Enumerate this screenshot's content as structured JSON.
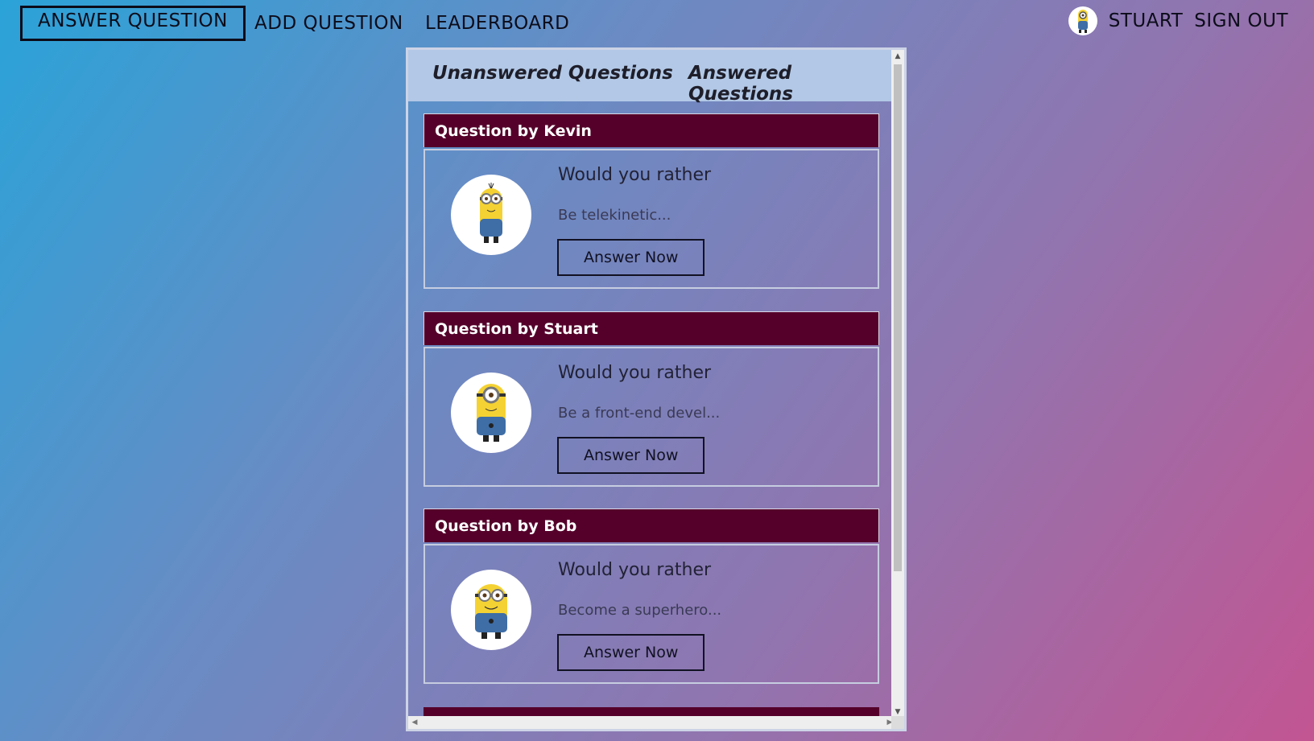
{
  "nav": {
    "answer_question": "ANSWER QUESTION",
    "add_question": "ADD QUESTION",
    "leaderboard": "LEADERBOARD"
  },
  "user": {
    "name": "STUART",
    "sign_out": "SIGN OUT",
    "avatar_icon": "minion-avatar-icon"
  },
  "tabs": {
    "unanswered": "Unanswered Questions",
    "answered": "Answered Questions"
  },
  "questions": [
    {
      "header": "Question by Kevin",
      "title": "Would you rather",
      "preview": "Be telekinetic...",
      "button": "Answer Now",
      "avatar_icon": "kevin-avatar-icon"
    },
    {
      "header": "Question by Stuart",
      "title": "Would you rather",
      "preview": "Be a front-end devel...",
      "button": "Answer Now",
      "avatar_icon": "stuart-avatar-icon"
    },
    {
      "header": "Question by Bob",
      "title": "Would you rather",
      "preview": "Become a superhero...",
      "button": "Answer Now",
      "avatar_icon": "bob-avatar-icon"
    }
  ],
  "colors": {
    "header_bg": "#55002a",
    "tabbar_bg": "#b2c8e6",
    "minion_yellow": "#f5d233",
    "minion_blue": "#3f6ea6"
  }
}
